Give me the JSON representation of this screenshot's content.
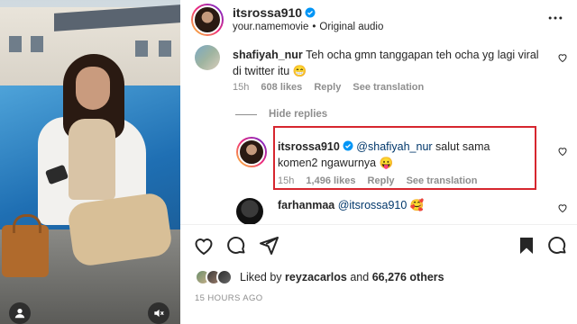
{
  "post": {
    "username": "itsrossa910",
    "subtitle_left": "your.namemovie",
    "subtitle_sep": "•",
    "subtitle_right": "Original audio"
  },
  "comments": [
    {
      "username": "shafiyah_nur",
      "text": "Teh ocha gmn tanggapan teh ocha yg lagi viral di twitter itu",
      "emoji": "😁",
      "time": "15h",
      "likes": "608 likes",
      "reply_label": "Reply",
      "translate_label": "See translation"
    }
  ],
  "hide_replies_label": "Hide replies",
  "reply": {
    "username": "itsrossa910",
    "mention": "@shafiyah_nur",
    "text": "salut sama komen2 ngawurnya",
    "emoji": "😛",
    "time": "15h",
    "likes": "1,496 likes",
    "reply_label": "Reply",
    "translate_label": "See translation"
  },
  "reply2": {
    "username": "farhanmaa",
    "mention": "@itsrossa910",
    "emoji": "🥰"
  },
  "likes_line": {
    "prefix": "Liked by",
    "user": "reyzacarlos",
    "connector": "and",
    "others": "66,276 others"
  },
  "timestamp": "15 HOURS AGO",
  "colors": {
    "highlight_border": "#d6262f",
    "verified": "#0095f6",
    "muted_text": "#8e8e8e",
    "mention": "#00376b"
  },
  "icons": [
    "verified-badge-icon",
    "more-options-icon",
    "heart-icon",
    "comment-icon",
    "share-icon",
    "bookmark-icon",
    "user-tag-icon",
    "muted-speaker-icon"
  ]
}
